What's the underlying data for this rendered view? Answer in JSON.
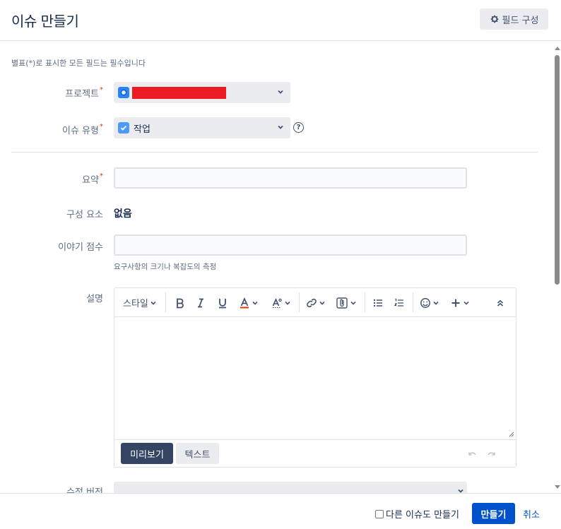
{
  "dialog": {
    "title": "이슈 만들기",
    "configure_fields": "필드 구성"
  },
  "form": {
    "required_note": "별표(*)로 표시한 모든 필드는 필수입니다",
    "project": {
      "label": "프로젝트",
      "required_mark": "*"
    },
    "issue_type": {
      "label": "이슈 유형",
      "required_mark": "*",
      "value": "작업",
      "help": "?"
    },
    "summary": {
      "label": "요약",
      "required_mark": "*",
      "value": ""
    },
    "components": {
      "label": "구성 요소",
      "value": "없음"
    },
    "story_points": {
      "label": "이야기 점수",
      "value": "",
      "help_text": "요구사항의 크기나 복잡도의 측정"
    },
    "description": {
      "label": "설명",
      "toolbar": {
        "style_label": "스타일",
        "buttons": [
          "bold-icon",
          "italic-icon",
          "underline-icon",
          "text-color-icon",
          "text-effects-icon",
          "link-icon",
          "attachment-icon",
          "bullet-list-icon",
          "numbered-list-icon",
          "emoji-icon",
          "insert-more-icon",
          "collapse-toolbar-icon"
        ]
      },
      "value": "",
      "preview_tab": "미리보기",
      "text_tab": "텍스트"
    },
    "fix_version": {
      "label": "수정 버전"
    }
  },
  "footer": {
    "create_another_label": "다른 이슈도 만들기",
    "create_another_checked": false,
    "create_button": "만들기",
    "cancel_link": "취소"
  },
  "colors": {
    "primary": "#0052cc",
    "required": "#de350b",
    "redaction": "#ed1c24",
    "preview_tab_bg": "#344563",
    "text_color_underline": "#de350b"
  }
}
